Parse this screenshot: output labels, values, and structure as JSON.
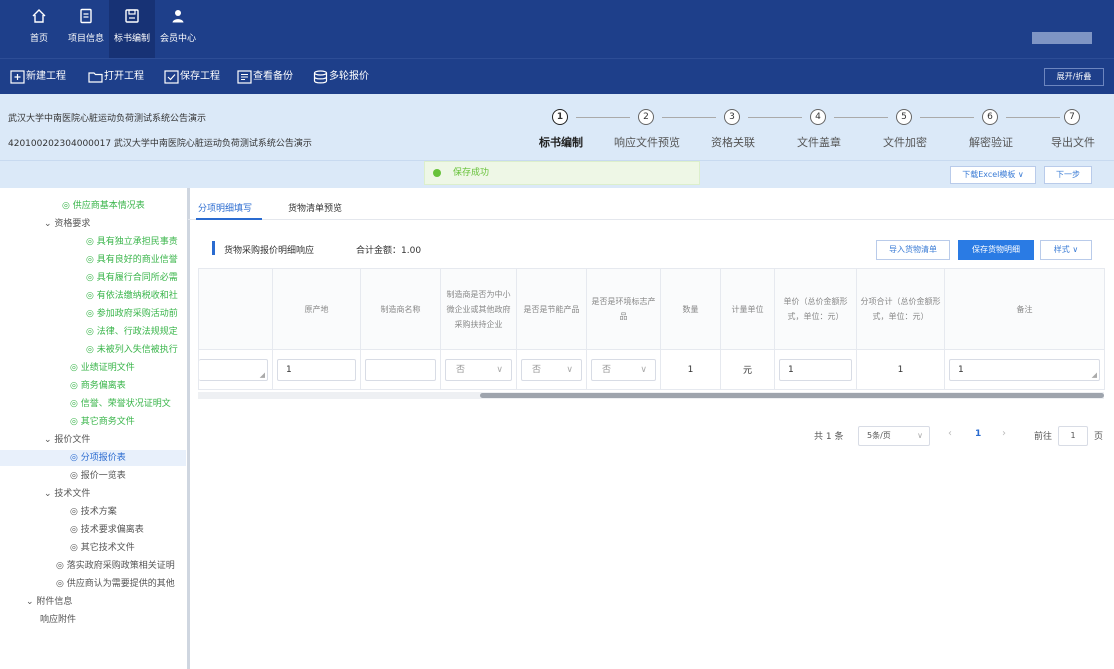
{
  "colors": {
    "nav_bg": "#1e3f8a",
    "accent": "#2a7be4",
    "success": "#67c23a",
    "tree_green": "#39b54a"
  },
  "nav": {
    "items": [
      {
        "label": "首页",
        "icon": "home-icon"
      },
      {
        "label": "项目信息",
        "icon": "document-icon"
      },
      {
        "label": "标书编制",
        "icon": "save-disk-icon",
        "active": true
      },
      {
        "label": "会员中心",
        "icon": "user-icon"
      }
    ]
  },
  "toolbar": {
    "new": "新建工程",
    "open": "打开工程",
    "save": "保存工程",
    "backup": "查看备份",
    "multi_quote": "多轮报价",
    "expand": "展开/折叠"
  },
  "project": {
    "title": "武汉大学中南医院心脏运动负荷测试系统公告演示",
    "subtitle": "420100202304000017 武汉大学中南医院心脏运动负荷测试系统公告演示"
  },
  "steps": [
    {
      "num": "1",
      "label": "标书编制",
      "active": true
    },
    {
      "num": "2",
      "label": "响应文件预览"
    },
    {
      "num": "3",
      "label": "资格关联"
    },
    {
      "num": "4",
      "label": "文件盖章"
    },
    {
      "num": "5",
      "label": "文件加密"
    },
    {
      "num": "6",
      "label": "解密验证"
    },
    {
      "num": "7",
      "label": "导出文件"
    }
  ],
  "actions": {
    "toast": "保存成功",
    "download_template": "下载Excel模板 ∨",
    "next": "下一步"
  },
  "sidebar": {
    "items": [
      "◎ 供应商基本情况表",
      "⌄ 资格要求",
      "◎ 具有独立承担民事责",
      "◎ 具有良好的商业信誉",
      "◎ 具有履行合同所必需",
      "◎ 有依法缴纳税收和社",
      "◎ 参加政府采购活动前",
      "◎ 法律、行政法规规定",
      "◎ 未被列入失信被执行",
      "◎ 业绩证明文件",
      "◎ 商务偏离表",
      "◎ 信誉、荣誉状况证明文",
      "◎ 其它商务文件",
      "⌄ 报价文件",
      "◎ 分项报价表",
      "◎ 报价一览表",
      "⌄ 技术文件",
      "◎ 技术方案",
      "◎ 技术要求偏离表",
      "◎ 其它技术文件",
      "◎ 落实政府采购政策相关证明",
      "◎ 供应商认为需要提供的其他",
      "⌄ 附件信息",
      "响应附件"
    ]
  },
  "tabs": {
    "fill": "分项明细填写",
    "preview": "货物清单预览"
  },
  "section": {
    "title": "货物采购报价明细响应",
    "total": "合计金额：1.00",
    "import_btn": "导入货物清单",
    "save_btn": "保存货物明细",
    "style_btn": "样式 ∨"
  },
  "table": {
    "headers": [
      "",
      "原产地",
      "制造商名称",
      "制造商是否为中小微企业或其他政府采购扶持企业",
      "是否是节能产品",
      "是否是环境标志产品",
      "数量",
      "计量单位",
      "单价（总价金额形式，单位：元）",
      "分项合计（总价金额形式，单位：元）",
      "备注"
    ],
    "row": {
      "origin": "1",
      "manufacturer": "",
      "sme": "否",
      "energy": "否",
      "env": "否",
      "qty": "1",
      "unit": "元",
      "price": "1",
      "subtotal": "1",
      "remark": "1"
    }
  },
  "pager": {
    "total": "共 1 条",
    "size": "5条/页",
    "page": "1",
    "goto_label": "前往",
    "goto_value": "1",
    "page_suffix": "页"
  }
}
